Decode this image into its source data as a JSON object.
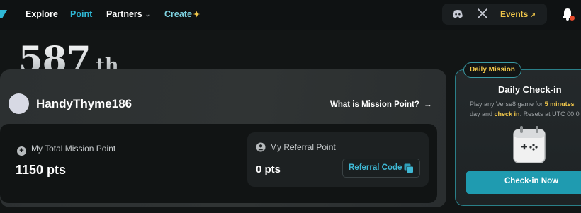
{
  "nav": {
    "items": [
      {
        "label": "Explore"
      },
      {
        "label": "Point"
      },
      {
        "label": "Partners"
      },
      {
        "label": "Create"
      }
    ],
    "events_label": "Events",
    "events_arrow": "↗",
    "sparkle": "✦",
    "chevron": "⌄"
  },
  "rank": {
    "number": "587",
    "suffix": "th"
  },
  "profile": {
    "username": "HandyThyme186",
    "what_is_link": "What is Mission Point?",
    "arrow": "→"
  },
  "stats": {
    "total_label": "My Total Mission Point",
    "total_value": "1150 pts",
    "referral_label": "My Referral Point",
    "referral_value": "0 pts",
    "referral_code_button": "Referral Code"
  },
  "mission": {
    "badge": "Daily Mission",
    "title": "Daily Check-in",
    "desc_line1_pre": "Play any Verse8 game for ",
    "desc_line1_hl": "5 minutes",
    "desc_line2_pre": "day and ",
    "desc_line2_hl": "check in",
    "desc_line2_post": ". Resets at UTC 00:0",
    "button": "Check-in Now"
  },
  "colors": {
    "accent": "#2fb8d6",
    "gold": "#f2c84b",
    "button_teal": "#1f9bb0",
    "notification_dot": "#e54a2c"
  }
}
